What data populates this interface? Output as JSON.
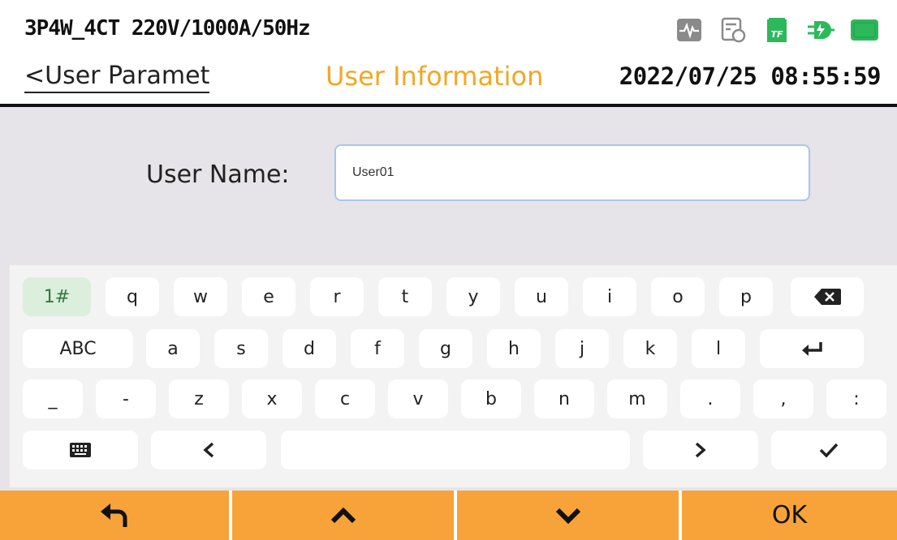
{
  "header": {
    "config": "3P4W_4CT 220V/1000A/50Hz",
    "back_label": "<User Paramet",
    "title": "User Information",
    "datetime": "2022/07/25 08:55:59",
    "status_icons": [
      "waveform-icon",
      "record-icon",
      "tf-card-icon",
      "power-plug-icon",
      "battery-icon"
    ],
    "tf_label": "TF"
  },
  "form": {
    "user_name_label": "User Name:",
    "user_name_value": "User01"
  },
  "keyboard": {
    "row1": [
      "1#",
      "q",
      "w",
      "e",
      "r",
      "t",
      "y",
      "u",
      "i",
      "o",
      "p"
    ],
    "row2": [
      "ABC",
      "a",
      "s",
      "d",
      "f",
      "g",
      "h",
      "j",
      "k",
      "l"
    ],
    "row3": [
      "_",
      "-",
      "z",
      "x",
      "c",
      "v",
      "b",
      "n",
      "m",
      ".",
      ",",
      ":"
    ],
    "icons": {
      "backspace": "backspace-icon",
      "enter": "enter-icon",
      "keyboard": "keyboard-icon",
      "left": "chevron-left-icon",
      "right": "chevron-right-icon",
      "confirm": "check-icon"
    }
  },
  "footer": {
    "back_icon": "undo-icon",
    "up_icon": "chevron-up-icon",
    "down_icon": "chevron-down-icon",
    "ok_label": "OK"
  },
  "colors": {
    "accent": "#f5a623",
    "footer_bg": "#f7a33a",
    "content_bg": "#e6e4e8",
    "green_key": "#dcefdc",
    "battery_green": "#2db85c"
  }
}
